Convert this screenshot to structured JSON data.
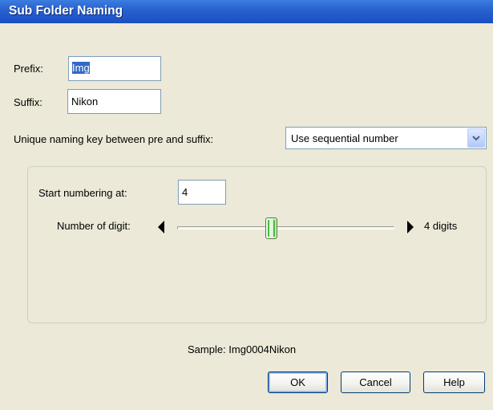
{
  "window": {
    "title": "Sub Folder Naming"
  },
  "prefix": {
    "label": "Prefix:",
    "value": "Img"
  },
  "suffix": {
    "label": "Suffix:",
    "value": "Nikon"
  },
  "naming_key": {
    "label": "Unique naming key between pre and suffix:",
    "selected": "Use sequential number"
  },
  "numbering": {
    "start_label": "Start numbering at:",
    "start_value": "4",
    "digits_label": "Number of digit:",
    "digits_value": 4,
    "digits_min": 1,
    "digits_max": 8,
    "digits_text": "4 digits"
  },
  "sample": {
    "text": "Sample: Img0004Nikon"
  },
  "buttons": {
    "ok": "OK",
    "cancel": "Cancel",
    "help": "Help"
  },
  "colors": {
    "titlebar": "#1f55c8",
    "dialog_bg": "#ece9d8",
    "selection": "#316ac5"
  }
}
